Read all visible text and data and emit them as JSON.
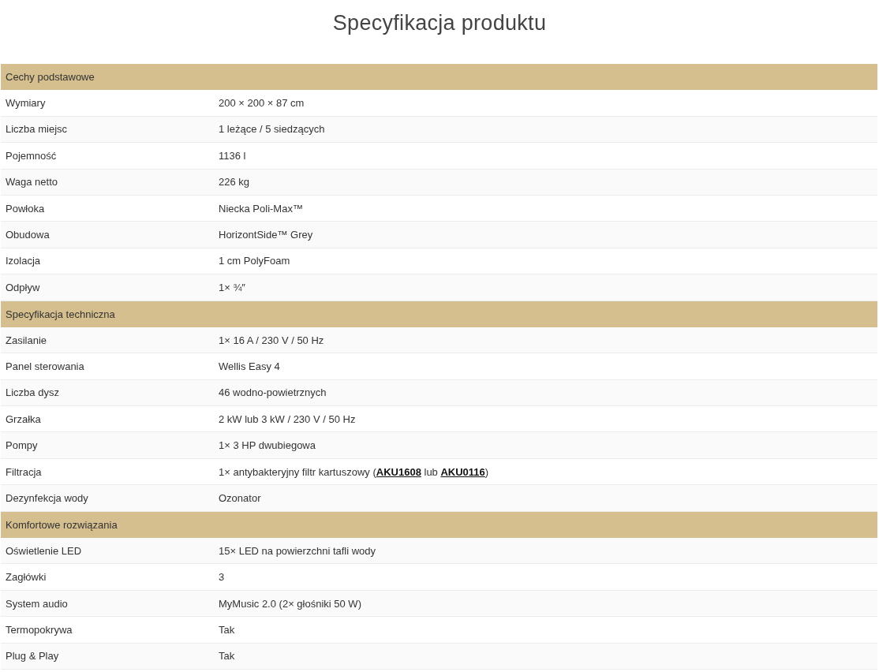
{
  "title": "Specyfikacja produktu",
  "sections": [
    {
      "heading": "Cechy podstawowe",
      "rows": [
        {
          "label": "Wymiary",
          "value": [
            {
              "kind": "text",
              "text": "200 × 200 × 87 cm"
            }
          ]
        },
        {
          "label": "Liczba miejsc",
          "value": [
            {
              "kind": "text",
              "text": "1 leżące / 5 siedzących"
            }
          ]
        },
        {
          "label": "Pojemność",
          "value": [
            {
              "kind": "text",
              "text": "1136 l"
            }
          ]
        },
        {
          "label": "Waga netto",
          "value": [
            {
              "kind": "text",
              "text": "226 kg"
            }
          ]
        },
        {
          "label": "Powłoka",
          "value": [
            {
              "kind": "text",
              "text": "Niecka Poli-Max™"
            }
          ]
        },
        {
          "label": "Obudowa",
          "value": [
            {
              "kind": "text",
              "text": "HorizontSide™ Grey"
            }
          ]
        },
        {
          "label": "Izolacja",
          "value": [
            {
              "kind": "text",
              "text": "1 cm PolyFoam"
            }
          ]
        },
        {
          "label": "Odpływ",
          "value": [
            {
              "kind": "text",
              "text": "1× ¾″"
            }
          ]
        }
      ]
    },
    {
      "heading": "Specyfikacja techniczna",
      "rows": [
        {
          "label": "Zasilanie",
          "value": [
            {
              "kind": "text",
              "text": "1× 16 A / 230 V / 50 Hz"
            }
          ]
        },
        {
          "label": "Panel sterowania",
          "value": [
            {
              "kind": "text",
              "text": "Wellis Easy 4"
            }
          ]
        },
        {
          "label": "Liczba dysz",
          "value": [
            {
              "kind": "text",
              "text": "46 wodno-powietrznych"
            }
          ]
        },
        {
          "label": "Grzałka",
          "value": [
            {
              "kind": "text",
              "text": "2 kW lub 3 kW / 230 V / 50 Hz"
            }
          ]
        },
        {
          "label": "Pompy",
          "value": [
            {
              "kind": "text",
              "text": "1× 3 HP dwubiegowa"
            }
          ]
        },
        {
          "label": "Filtracja",
          "value": [
            {
              "kind": "text",
              "text": "1× antybakteryjny filtr kartuszowy ("
            },
            {
              "kind": "link",
              "text": "AKU1608"
            },
            {
              "kind": "text",
              "text": " lub "
            },
            {
              "kind": "link",
              "text": "AKU0116"
            },
            {
              "kind": "text",
              "text": ")"
            }
          ]
        },
        {
          "label": "Dezynfekcja wody",
          "value": [
            {
              "kind": "text",
              "text": "Ozonator"
            }
          ]
        }
      ]
    },
    {
      "heading": "Komfortowe rozwiązania",
      "rows": [
        {
          "label": "Oświetlenie LED",
          "value": [
            {
              "kind": "text",
              "text": "15× LED na powierzchni tafli wody"
            }
          ]
        },
        {
          "label": "Zagłówki",
          "value": [
            {
              "kind": "text",
              "text": "3"
            }
          ]
        },
        {
          "label": "System audio",
          "value": [
            {
              "kind": "text",
              "text": "MyMusic 2.0 (2× głośniki 50 W)"
            }
          ]
        },
        {
          "label": "Termopokrywa",
          "value": [
            {
              "kind": "text",
              "text": "Tak"
            }
          ]
        },
        {
          "label": "Plug & Play",
          "value": [
            {
              "kind": "text",
              "text": "Tak"
            }
          ]
        }
      ]
    }
  ]
}
